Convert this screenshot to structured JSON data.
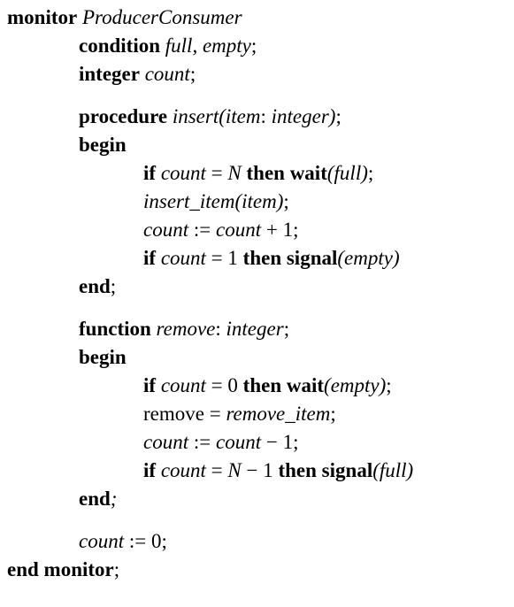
{
  "lines": [
    {
      "indent": 0,
      "parts": [
        {
          "t": "monitor",
          "s": "b"
        },
        {
          "t": " "
        },
        {
          "t": "ProducerConsumer",
          "s": "i"
        }
      ]
    },
    {
      "indent": 1,
      "parts": [
        {
          "t": "condition",
          "s": "b"
        },
        {
          "t": " "
        },
        {
          "t": "full, empty",
          "s": "i"
        },
        {
          "t": ";"
        }
      ]
    },
    {
      "indent": 1,
      "parts": [
        {
          "t": "integer",
          "s": "b"
        },
        {
          "t": " "
        },
        {
          "t": "count",
          "s": "i"
        },
        {
          "t": ";"
        }
      ]
    },
    {
      "indent": 1,
      "parts": [
        {
          "t": "procedure",
          "s": "b"
        },
        {
          "t": " "
        },
        {
          "t": "insert(item",
          "s": "i"
        },
        {
          "t": ": "
        },
        {
          "t": "integer)",
          "s": "i"
        },
        {
          "t": ";"
        }
      ]
    },
    {
      "indent": 1,
      "parts": [
        {
          "t": "begin",
          "s": "b"
        }
      ]
    },
    {
      "indent": 2,
      "parts": [
        {
          "t": "if",
          "s": "b"
        },
        {
          "t": " "
        },
        {
          "t": "count",
          "s": "i"
        },
        {
          "t": " = "
        },
        {
          "t": "N",
          "s": "i"
        },
        {
          "t": " "
        },
        {
          "t": "then wait",
          "s": "b"
        },
        {
          "t": "(full)",
          "s": "i"
        },
        {
          "t": ";"
        }
      ]
    },
    {
      "indent": 2,
      "parts": [
        {
          "t": "insert_item(item)",
          "s": "i"
        },
        {
          "t": ";"
        }
      ]
    },
    {
      "indent": 2,
      "parts": [
        {
          "t": "count",
          "s": "i"
        },
        {
          "t": " := "
        },
        {
          "t": "count",
          "s": "i"
        },
        {
          "t": " + 1;"
        }
      ]
    },
    {
      "indent": 2,
      "parts": [
        {
          "t": "if",
          "s": "b"
        },
        {
          "t": " "
        },
        {
          "t": "count",
          "s": "i"
        },
        {
          "t": " = 1 "
        },
        {
          "t": "then signal",
          "s": "b"
        },
        {
          "t": "(empty)",
          "s": "i"
        }
      ]
    },
    {
      "indent": 1,
      "parts": [
        {
          "t": "end",
          "s": "b"
        },
        {
          "t": ";"
        }
      ]
    },
    {
      "indent": 1,
      "parts": [
        {
          "t": "function",
          "s": "b"
        },
        {
          "t": " "
        },
        {
          "t": "remove",
          "s": "i"
        },
        {
          "t": ": "
        },
        {
          "t": "integer",
          "s": "i"
        },
        {
          "t": ";"
        }
      ]
    },
    {
      "indent": 1,
      "parts": [
        {
          "t": "begin",
          "s": "b"
        }
      ]
    },
    {
      "indent": 2,
      "parts": [
        {
          "t": "if",
          "s": "b"
        },
        {
          "t": " "
        },
        {
          "t": "count",
          "s": "i"
        },
        {
          "t": " = 0 "
        },
        {
          "t": "then wait",
          "s": "b"
        },
        {
          "t": "(empty)",
          "s": "i"
        },
        {
          "t": ";"
        }
      ]
    },
    {
      "indent": 2,
      "parts": [
        {
          "t": "remove = "
        },
        {
          "t": "remove_item",
          "s": "i"
        },
        {
          "t": ";"
        }
      ]
    },
    {
      "indent": 2,
      "parts": [
        {
          "t": "count",
          "s": "i"
        },
        {
          "t": " := "
        },
        {
          "t": "count",
          "s": "i"
        },
        {
          "t": " − 1;"
        }
      ]
    },
    {
      "indent": 2,
      "parts": [
        {
          "t": "if",
          "s": "b"
        },
        {
          "t": " "
        },
        {
          "t": "count",
          "s": "i"
        },
        {
          "t": " = "
        },
        {
          "t": "N",
          "s": "i"
        },
        {
          "t": " − 1 "
        },
        {
          "t": "then signal",
          "s": "b"
        },
        {
          "t": "(full)",
          "s": "i"
        }
      ]
    },
    {
      "indent": 1,
      "parts": [
        {
          "t": "end",
          "s": "b"
        },
        {
          "t": ";",
          "s": "i"
        }
      ]
    },
    {
      "indent": 1,
      "parts": [
        {
          "t": "count",
          "s": "i"
        },
        {
          "t": " := 0;"
        }
      ]
    },
    {
      "indent": 0,
      "parts": [
        {
          "t": "end monitor",
          "s": "b"
        },
        {
          "t": ";"
        }
      ]
    }
  ]
}
